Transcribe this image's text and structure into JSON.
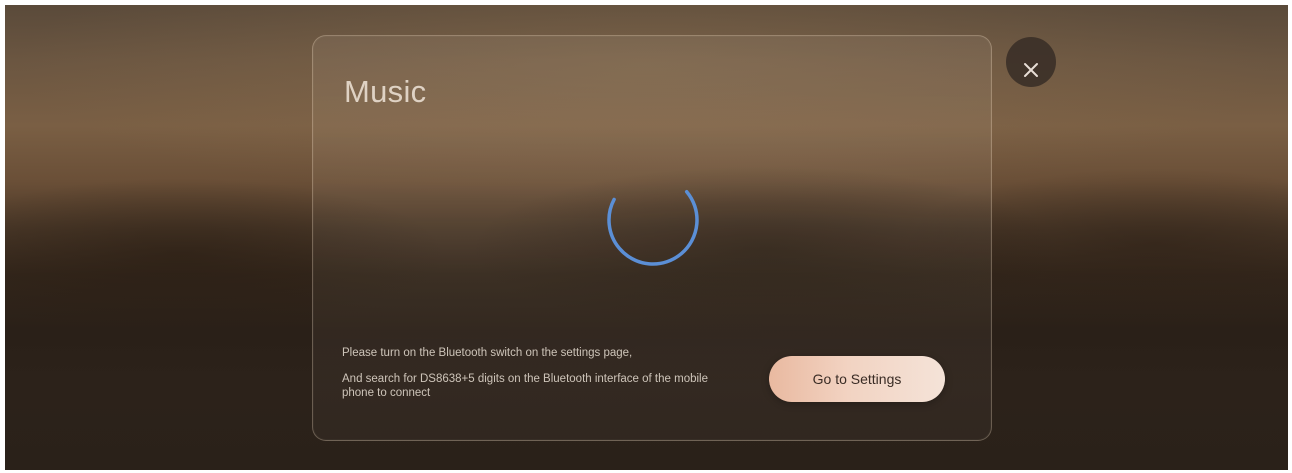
{
  "dialog": {
    "title": "Music",
    "message_line1": "Please turn on the Bluetooth switch on the settings page,",
    "message_line2": "And search for DS8638+5 digits on the Bluetooth interface of the mobile phone to connect",
    "settings_button_label": "Go to Settings"
  },
  "icons": {
    "close": "close-icon",
    "spinner": "loading-spinner-icon"
  },
  "colors": {
    "spinner": "#5b8fd6",
    "button_gradient_start": "#e9b9a0",
    "button_gradient_end": "#f4e3d8"
  }
}
